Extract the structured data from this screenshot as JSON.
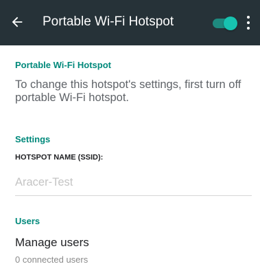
{
  "appbar": {
    "title": "Portable Wi-Fi Hotspot",
    "back_icon": "back-arrow-icon",
    "toggle_state": "on",
    "overflow_icon": "more-vert-icon",
    "colors": {
      "background": "#263238",
      "toggle_accent": "#17c3b0"
    }
  },
  "hotspot_section": {
    "heading": "Portable Wi-Fi Hotspot",
    "message": "To change this hotspot's settings, first turn off portable Wi-Fi hotspot."
  },
  "settings_section": {
    "heading": "Settings",
    "ssid_label": "HOTSPOT NAME (SSID):",
    "ssid_value": "Aracer-Test"
  },
  "users_section": {
    "heading": "Users",
    "manage_label": "Manage users",
    "connected_count": "0 connected users"
  },
  "accent_color": "#00897b"
}
